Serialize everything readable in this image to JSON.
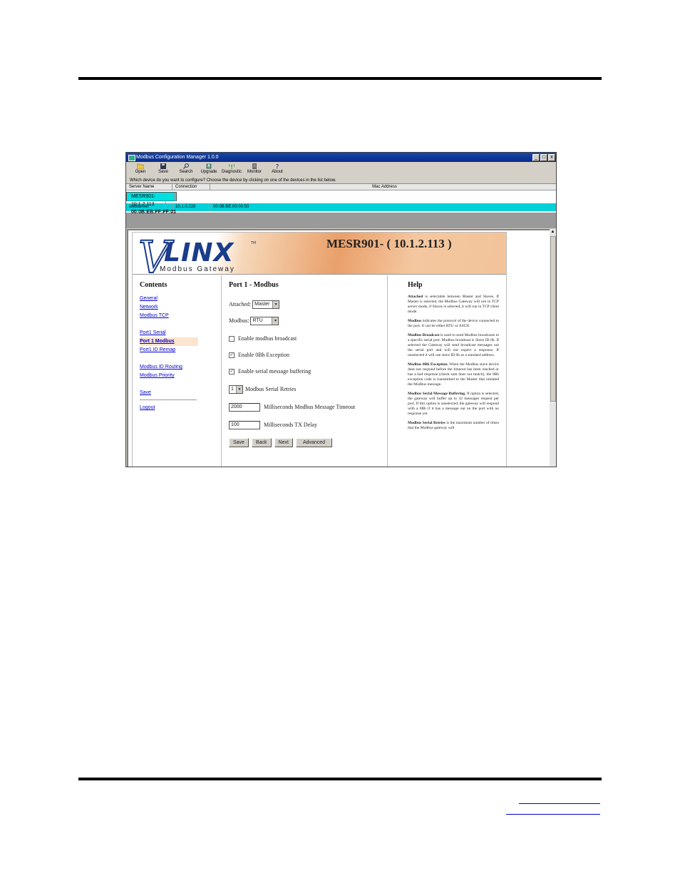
{
  "window": {
    "title": "Modbus Configuration Manager 1.0.0",
    "controls": [
      "_",
      "□",
      "x"
    ]
  },
  "toolbar": [
    {
      "label": "Open",
      "icon": "folder-icon"
    },
    {
      "label": "Save",
      "icon": "floppy-icon"
    },
    {
      "label": "Search",
      "icon": "search-icon"
    },
    {
      "label": "Upgrade",
      "icon": "upgrade-icon"
    },
    {
      "label": "Diagnostic",
      "icon": "antenna-icon"
    },
    {
      "label": "Monitor",
      "icon": "monitor-icon"
    },
    {
      "label": "About",
      "icon": "question-icon"
    }
  ],
  "prompt": "Which device do you want to configure? Choose the device by clicking on one of the devices in the list below.",
  "devices": {
    "headers": [
      "Server Name",
      "Connection",
      "Mac Address"
    ],
    "rows": [
      [
        "MESR901-",
        "10.1.2.113",
        "00:0B:EB:FF:FF:01"
      ],
      [
        "webserver",
        "10.1.0.226",
        "00:0B:BE:00:00:50"
      ]
    ]
  },
  "banner": {
    "logo_text": "LINX",
    "logo_letter": "V",
    "tm": "TM",
    "subtitle": "Modbus Gateway",
    "device_title": "MESR901- ( 10.1.2.113 )"
  },
  "contents": {
    "heading": "Contents",
    "links": {
      "general": "General",
      "network": "Network",
      "modbus_tcp": "Modbus TCP",
      "port1_serial": "Port1 Serial",
      "port1_modbus": "Port 1 Modbus",
      "port1_id_remap": "Port1 ID Remap",
      "modbus_id_routing": "Modbus ID Routing",
      "modbus_priority": "Modbus Priority",
      "save": "Save",
      "logout": "Logout"
    }
  },
  "main": {
    "heading": "Port 1 - Modbus",
    "attached_label": "Attached:",
    "attached_value": "Master",
    "modbus_label": "Modbus:",
    "modbus_value": "RTU",
    "broadcast_label": "Enable modbus broadcast",
    "broadcast_checked": false,
    "exception_label": "Enable 0Bh Exception",
    "exception_checked": true,
    "buffering_label": "Enable serial message buffering",
    "buffering_checked": true,
    "retries_value": "1",
    "retries_label": "Modbus Serial Retries",
    "timeout_value": "2000",
    "timeout_label": "Milliseconds Modbus Message Timeout",
    "txdelay_value": "100",
    "txdelay_label": "Milliseconds TX Delay",
    "buttons": {
      "save": "Save",
      "back": "Back",
      "next": "Next",
      "advanced": "Advanced"
    }
  },
  "help": {
    "heading": "Help",
    "paragraphs": [
      {
        "term": "Attached",
        "text": " is selectable between Master and Slaves. If Master is selected, the Modbus Gateway will run in TCP server mode, if Slaves is selected, it will run in TCP client mode."
      },
      {
        "term": "Modbus",
        "text": " indicates the protocol of the device connected to the port. It can be either RTU or ASCII."
      },
      {
        "term": "Modbus Broadcast",
        "text": " is used to send Modbus broadcasts to a specific serial port. Modbus broadcast is Slave ID 0h. If selected the Gateway will send broadcast messages out the serial port and will not expect a response. If unselected it will use slave ID 0h as a standard address."
      },
      {
        "term": "Modbus 0Bh Exception.",
        "text": " When the Modbus slave device does not respond before the timeout has been reached or has a bad response (check sum does not match), the 0Bh exception code is transmitted to the Master that initiated the Modbus message."
      },
      {
        "term": "Modbus Serial Message Buffering.",
        "text": " If option is selected, the gateway will buffer up to 32 messages request per port. If this option is unselected, the gateway will respond with a 0Bh if it has a message out on the port with no response yet."
      },
      {
        "term": "Modbus Serial Retries",
        "text": " is the maximum number of times that the Modbus gateway will"
      }
    ]
  }
}
